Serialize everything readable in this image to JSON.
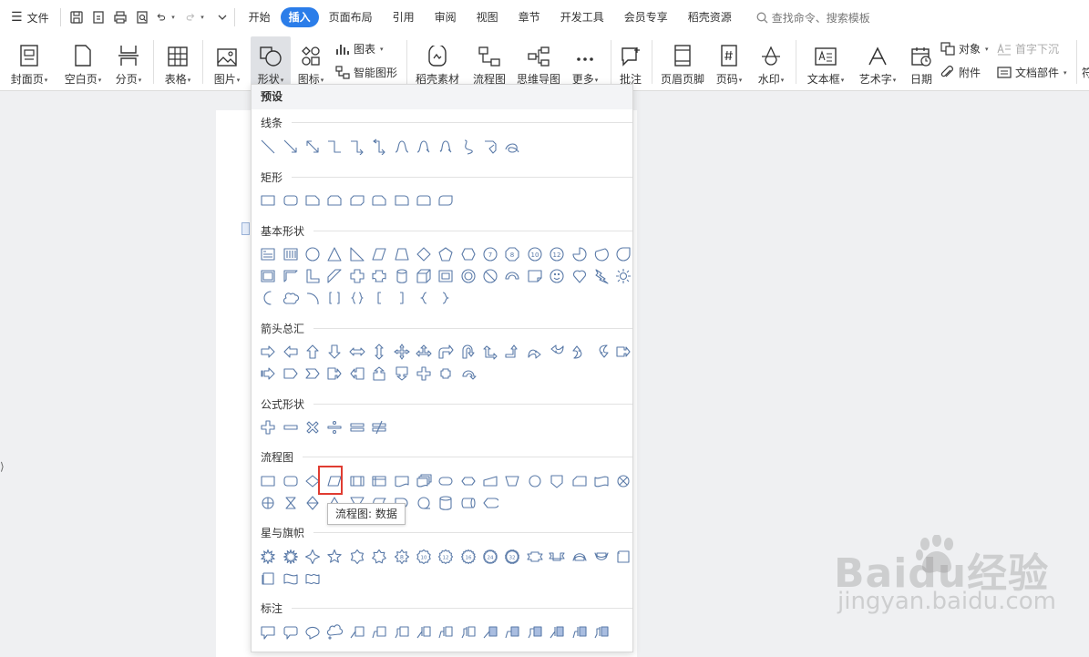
{
  "menubar": {
    "file_label": "文件",
    "tabs": [
      "开始",
      "插入",
      "页面布局",
      "引用",
      "审阅",
      "视图",
      "章节",
      "开发工具",
      "会员专享",
      "稻壳资源"
    ],
    "active_tab": "插入",
    "search_placeholder": "查找命令、搜索模板"
  },
  "ribbon": {
    "cover": "封面页",
    "blank": "空白页",
    "break": "分页",
    "table": "表格",
    "picture": "图片",
    "shapes": "形状",
    "icons": "图标",
    "chart": "图表",
    "smart": "智能图形",
    "docer": "稻壳素材",
    "flow": "流程图",
    "mind": "思维导图",
    "more": "更多",
    "comment": "批注",
    "header": "页眉页脚",
    "pagenum": "页码",
    "watermark": "水印",
    "textbox": "文本框",
    "wordart": "艺术字",
    "date": "日期",
    "object": "对象",
    "attach": "附件",
    "dropcap": "首字下沉",
    "docpart": "文档部件",
    "cut": "符"
  },
  "panel": {
    "header": "预设",
    "sections": [
      "线条",
      "矩形",
      "基本形状",
      "箭头总汇",
      "公式形状",
      "流程图",
      "星与旗帜",
      "标注"
    ],
    "tooltip": "流程图: 数据"
  },
  "watermark": {
    "logo": "Baidu经验",
    "url": "jingyan.baidu.com"
  },
  "colors": {
    "accent": "#2b7de9",
    "shape_stroke": "#5a7aa8",
    "highlight": "#e03c31"
  }
}
